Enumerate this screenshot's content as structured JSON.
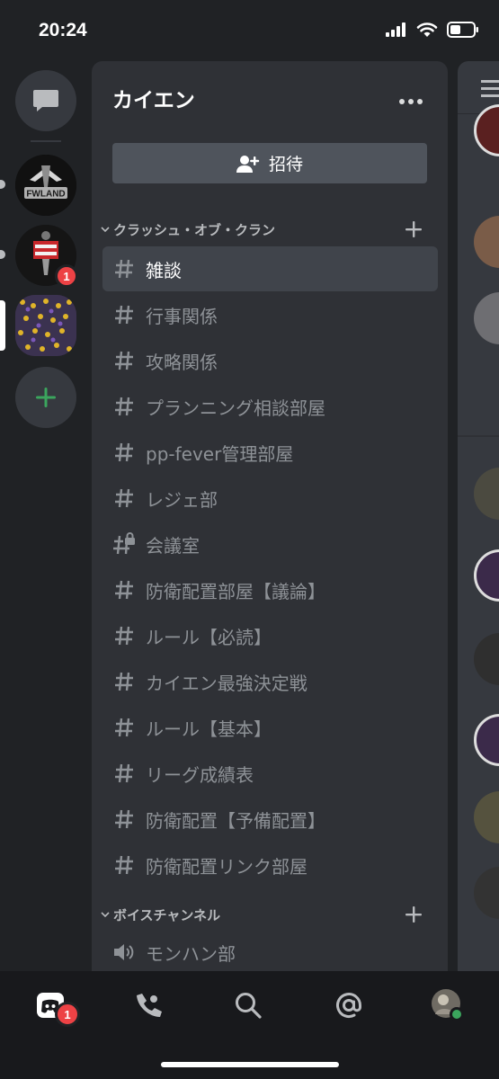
{
  "status": {
    "time": "20:24"
  },
  "rail": {
    "servers": [
      {
        "name": "FWLAND",
        "badge": ""
      },
      {
        "name": "",
        "badge": "1"
      },
      {
        "name": "",
        "badge": ""
      }
    ]
  },
  "server": {
    "name": "カイエン",
    "invite_label": "招待"
  },
  "categories": [
    {
      "name": "クラッシュ・オブ・クラン"
    },
    {
      "name": "ボイスチャンネル"
    }
  ],
  "channels": [
    {
      "label": "雑談",
      "icon": "hash-icon",
      "selected": true
    },
    {
      "label": "行事関係",
      "icon": "hash-icon"
    },
    {
      "label": "攻略関係",
      "icon": "hash-icon"
    },
    {
      "label": "プランニング相談部屋",
      "icon": "hash-icon"
    },
    {
      "label": "pp-fever管理部屋",
      "icon": "hash-icon"
    },
    {
      "label": "レジェ部",
      "icon": "hash-icon"
    },
    {
      "label": "会議室",
      "icon": "locked-hash-icon"
    },
    {
      "label": "防衛配置部屋【議論】",
      "icon": "hash-icon"
    },
    {
      "label": "ルール【必読】",
      "icon": "hash-icon"
    },
    {
      "label": "カイエン最強決定戦",
      "icon": "hash-icon"
    },
    {
      "label": "ルール【基本】",
      "icon": "hash-icon"
    },
    {
      "label": "リーグ成績表",
      "icon": "hash-icon"
    },
    {
      "label": "防衛配置【予備配置】",
      "icon": "hash-icon"
    },
    {
      "label": "防衛配置リンク部屋",
      "icon": "hash-icon"
    }
  ],
  "voice_channels": [
    {
      "label": "モンハン部",
      "icon": "speaker-icon"
    }
  ],
  "tabs": {
    "home_badge": "1",
    "items": [
      "home-icon",
      "friends-icon",
      "search-icon",
      "mentions-icon",
      "profile-avatar"
    ]
  },
  "colors": {
    "rail_bg": "#202225",
    "panel_bg": "#2f3136",
    "selected_bg": "#40444b",
    "accent_green": "#3ba55d",
    "badge_red": "#ed4245"
  }
}
